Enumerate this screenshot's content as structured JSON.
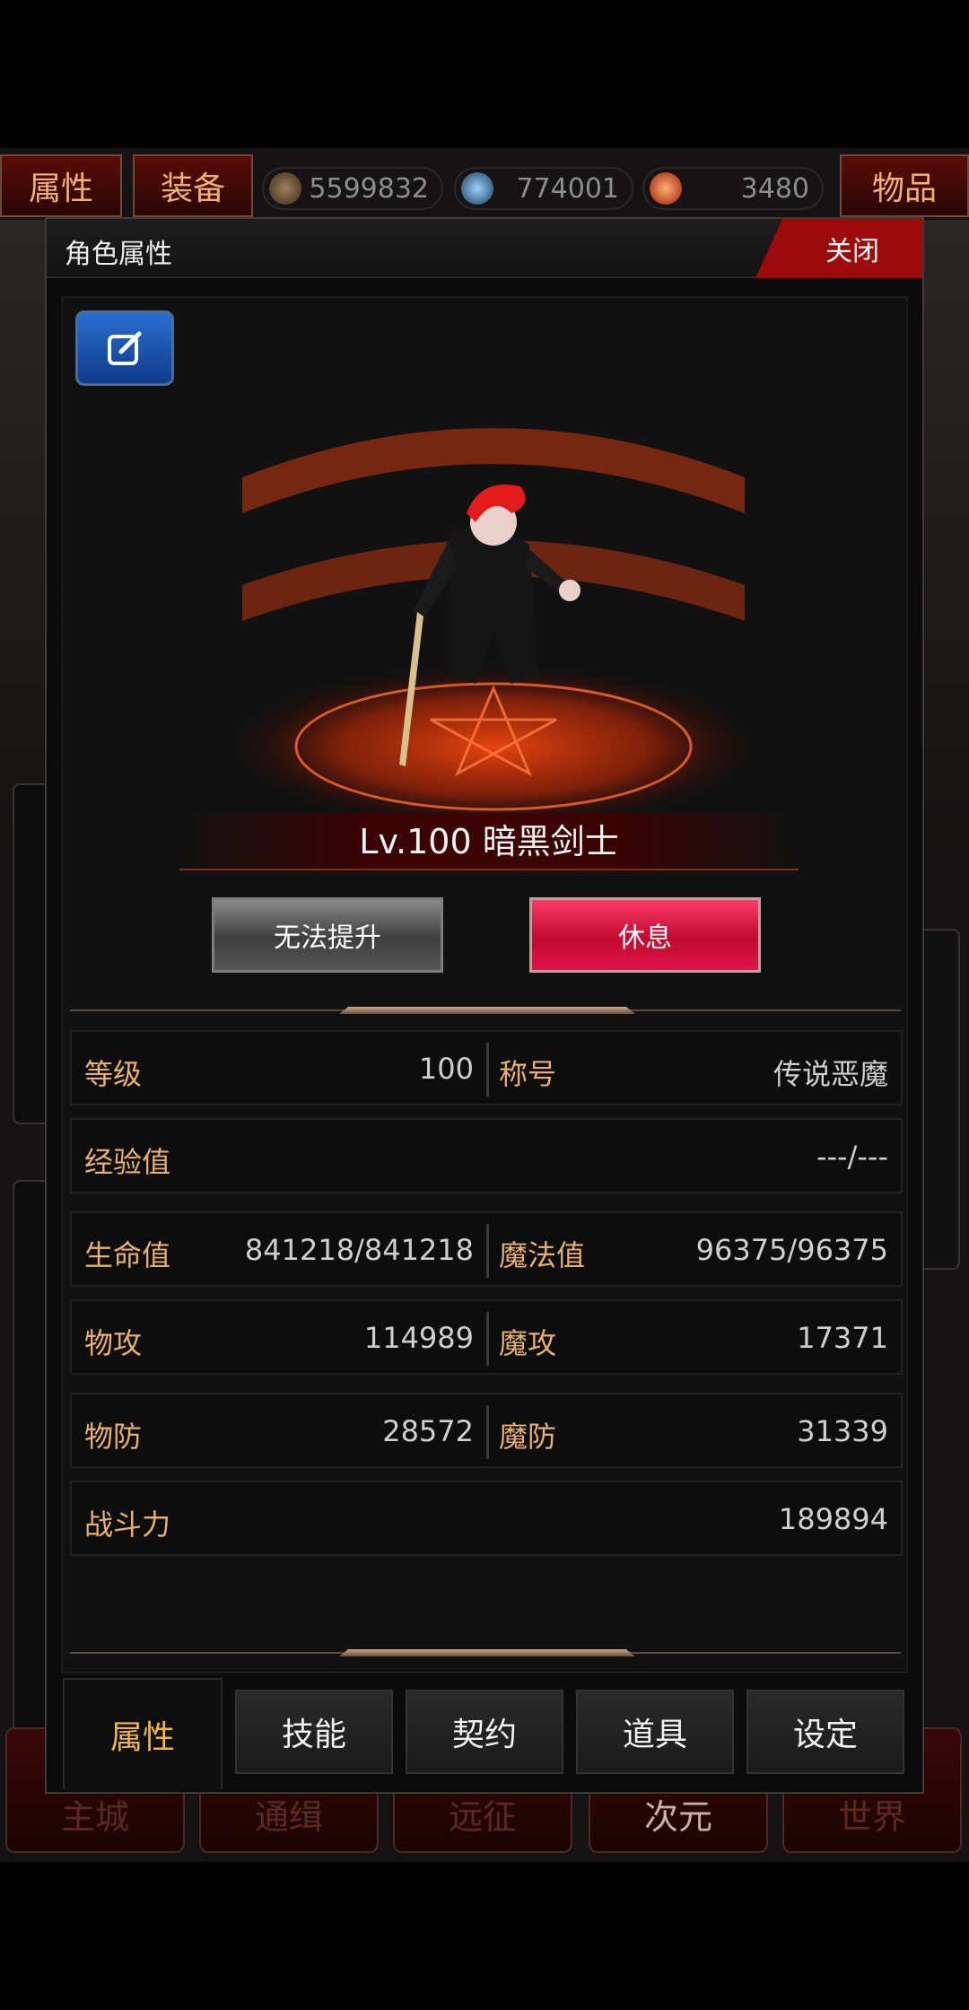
{
  "top_bar": {
    "tab_attributes": "属性",
    "tab_equipment": "装备",
    "tab_items": "物品",
    "gold": "5599832",
    "soul": "774001",
    "gem": "3480"
  },
  "bottom_nav": [
    "主城",
    "通缉",
    "远征",
    "次元",
    "世界"
  ],
  "modal": {
    "title": "角色属性",
    "close_label": "关闭",
    "character_name": "Lv.100 暗黑剑士",
    "btn_upgrade": "无法提升",
    "btn_rest": "休息"
  },
  "stats": {
    "level_label": "等级",
    "level_value": "100",
    "title_label": "称号",
    "title_value": "传说恶魔",
    "exp_label": "经验值",
    "exp_value": "---/---",
    "hp_label": "生命值",
    "hp_value": "841218/841218",
    "mp_label": "魔法值",
    "mp_value": "96375/96375",
    "patk_label": "物攻",
    "patk_value": "114989",
    "matk_label": "魔攻",
    "matk_value": "17371",
    "pdef_label": "物防",
    "pdef_value": "28572",
    "mdef_label": "魔防",
    "mdef_value": "31339",
    "power_label": "战斗力",
    "power_value": "189894"
  },
  "tabs": {
    "attributes": "属性",
    "skills": "技能",
    "contract": "契约",
    "items": "道具",
    "settings": "设定"
  },
  "colors": {
    "accent_gold": "#e8b070",
    "close_red": "#9c0a0a",
    "rest_pink": "#e0144a",
    "edit_blue": "#2b6fd1"
  }
}
